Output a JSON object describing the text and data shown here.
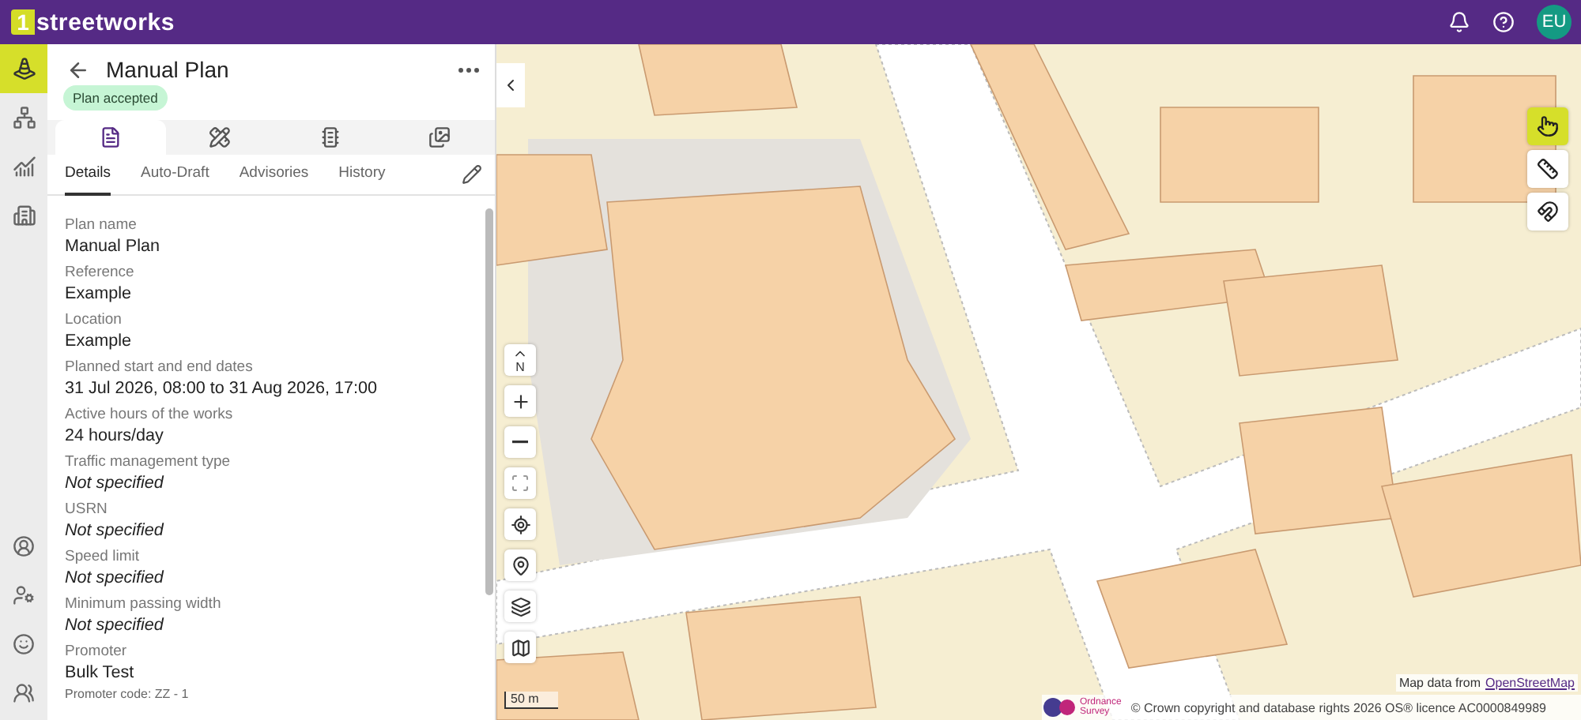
{
  "header": {
    "logo_mark": "1",
    "logo_text": "streetworks",
    "avatar": "EU"
  },
  "rail": {
    "top_items": [
      {
        "selected": true
      },
      {
        "selected": false
      },
      {
        "selected": false
      },
      {
        "selected": false
      }
    ],
    "bottom_items": [
      {
        "selected": false
      },
      {
        "selected": false
      },
      {
        "selected": false
      },
      {
        "selected": false
      }
    ]
  },
  "panel": {
    "title": "Manual Plan",
    "status": "Plan accepted",
    "icon_tabs": [
      {
        "selected": true
      },
      {
        "selected": false
      },
      {
        "selected": false
      },
      {
        "selected": false
      }
    ],
    "tabs": [
      {
        "label": "Details",
        "selected": true
      },
      {
        "label": "Auto-Draft",
        "selected": false
      },
      {
        "label": "Advisories",
        "selected": false
      },
      {
        "label": "History",
        "selected": false
      }
    ],
    "fields": [
      {
        "label": "Plan name",
        "value": "Manual Plan",
        "kind": "text"
      },
      {
        "label": "Reference",
        "value": "Example",
        "kind": "text"
      },
      {
        "label": "Location",
        "value": "Example",
        "kind": "text"
      },
      {
        "label": "Planned start and end dates",
        "value": "31 Jul 2026, 08:00 to 31 Aug 2026, 17:00",
        "kind": "text"
      },
      {
        "label": "Active hours of the works",
        "value": "24 hours/day",
        "kind": "text"
      },
      {
        "label": "Traffic management type",
        "value": "Not specified",
        "kind": "empty"
      },
      {
        "label": "USRN",
        "value": "Not specified",
        "kind": "empty"
      },
      {
        "label": "Speed limit",
        "value": "Not specified",
        "kind": "empty"
      },
      {
        "label": "Minimum passing width",
        "value": "Not specified",
        "kind": "empty"
      },
      {
        "label": "Promoter",
        "value": "Bulk Test",
        "kind": "text",
        "note": "Promoter code: ZZ - 1"
      }
    ]
  },
  "map": {
    "compass": "N",
    "scale": "50 m",
    "tools": [
      {
        "selected": true
      },
      {
        "selected": false
      },
      {
        "selected": false
      }
    ],
    "attribution": {
      "prefix": "Map data from",
      "link": "OpenStreetMap"
    },
    "os_logo": {
      "line_1": "Ordnance",
      "line_2": "Survey"
    },
    "copyright": "© Crown copyright and database rights 2026 OS® licence AC0000849989"
  }
}
